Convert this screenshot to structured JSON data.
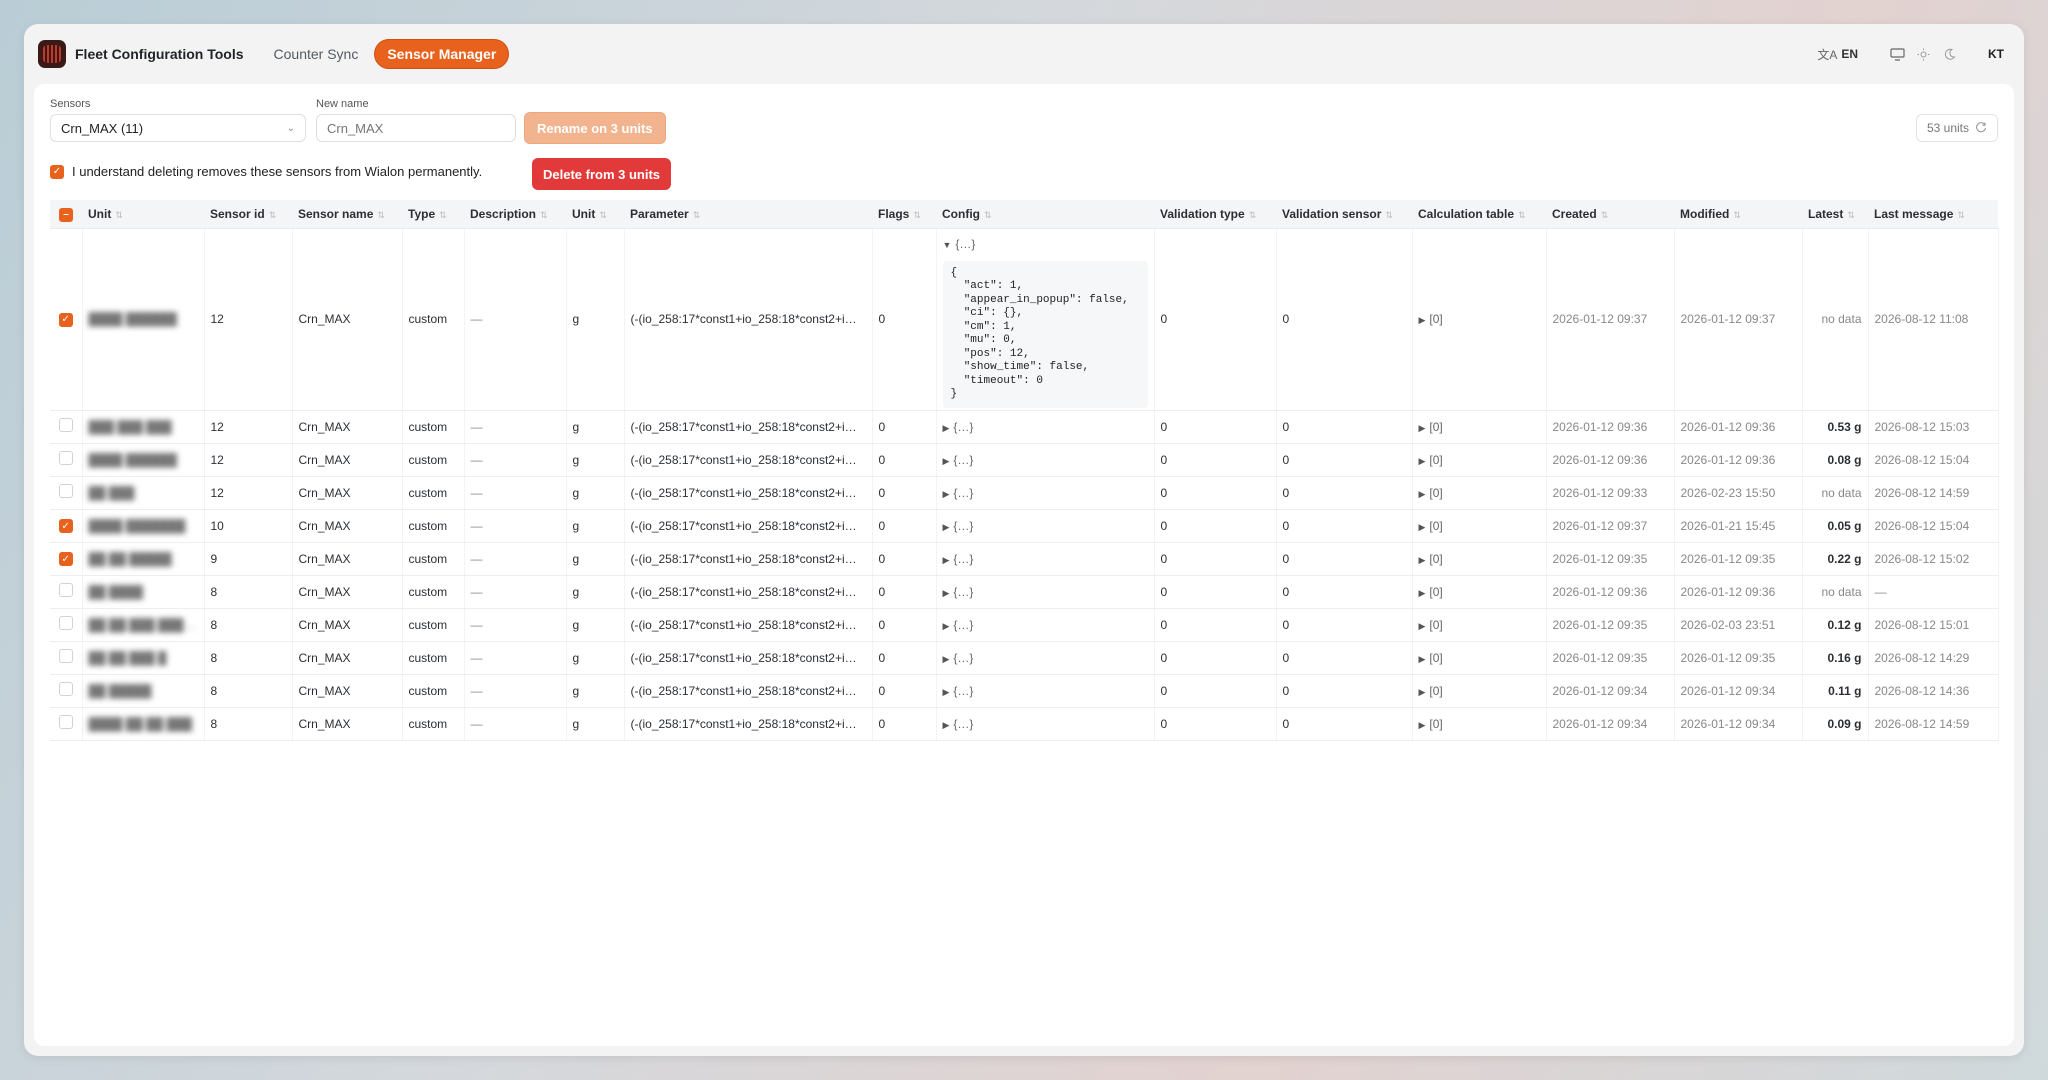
{
  "app": {
    "title": "Fleet Configuration Tools",
    "user_initials": "KT",
    "language": "EN"
  },
  "tabs": [
    {
      "label": "Counter Sync",
      "active": false
    },
    {
      "label": "Sensor Manager",
      "active": true
    }
  ],
  "form": {
    "sensors_label": "Sensors",
    "sensors_value": "Crn_MAX (11)",
    "new_name_label": "New name",
    "new_name_placeholder": "Crn_MAX",
    "rename_button": "Rename on 3 units",
    "units_count": "53 units"
  },
  "confirm": {
    "text": "I understand deleting removes these sensors from Wialon permanently.",
    "checked": true,
    "delete_button": "Delete from 3 units"
  },
  "table": {
    "columns": [
      "Unit",
      "Sensor id",
      "Sensor name",
      "Type",
      "Description",
      "Unit",
      "Parameter",
      "Flags",
      "Config",
      "Validation type",
      "Validation sensor",
      "Calculation table",
      "Created",
      "Modified",
      "Latest",
      "Last message"
    ],
    "config_collapsed": "{…}",
    "config_expanded_json": "{\n  \"act\": 1,\n  \"appear_in_popup\": false,\n  \"ci\": {},\n  \"cm\": 1,\n  \"mu\": 0,\n  \"pos\": 12,\n  \"show_time\": false,\n  \"timeout\": 0\n}",
    "rows": [
      {
        "checked": true,
        "unit": "████ ██████",
        "sensor_id": "12",
        "sensor_name": "Crn_MAX",
        "type": "custom",
        "description": "—",
        "unit_of": "g",
        "parameter": "(-(io_258:17*const1+io_258:18*const2+i…",
        "flags": "0",
        "expanded": true,
        "validation_type": "0",
        "validation_sensor": "0",
        "calc_table": "[0]",
        "created": "2026-01-12 09:37",
        "modified": "2026-01-12 09:37",
        "latest": "no data",
        "last_message": "2026-08-12 11:08"
      },
      {
        "checked": false,
        "unit": "███ ███ ███",
        "sensor_id": "12",
        "sensor_name": "Crn_MAX",
        "type": "custom",
        "description": "—",
        "unit_of": "g",
        "parameter": "(-(io_258:17*const1+io_258:18*const2+i…",
        "flags": "0",
        "expanded": false,
        "validation_type": "0",
        "validation_sensor": "0",
        "calc_table": "[0]",
        "created": "2026-01-12 09:36",
        "modified": "2026-01-12 09:36",
        "latest": "0.53 g",
        "last_message": "2026-08-12 15:03"
      },
      {
        "checked": false,
        "unit": "████ ██████",
        "sensor_id": "12",
        "sensor_name": "Crn_MAX",
        "type": "custom",
        "description": "—",
        "unit_of": "g",
        "parameter": "(-(io_258:17*const1+io_258:18*const2+i…",
        "flags": "0",
        "expanded": false,
        "validation_type": "0",
        "validation_sensor": "0",
        "calc_table": "[0]",
        "created": "2026-01-12 09:36",
        "modified": "2026-01-12 09:36",
        "latest": "0.08 g",
        "last_message": "2026-08-12 15:04"
      },
      {
        "checked": false,
        "unit": "██ ███",
        "sensor_id": "12",
        "sensor_name": "Crn_MAX",
        "type": "custom",
        "description": "—",
        "unit_of": "g",
        "parameter": "(-(io_258:17*const1+io_258:18*const2+i…",
        "flags": "0",
        "expanded": false,
        "validation_type": "0",
        "validation_sensor": "0",
        "calc_table": "[0]",
        "created": "2026-01-12 09:33",
        "modified": "2026-02-23 15:50",
        "latest": "no data",
        "last_message": "2026-08-12 14:59"
      },
      {
        "checked": true,
        "unit": "████ ███████",
        "sensor_id": "10",
        "sensor_name": "Crn_MAX",
        "type": "custom",
        "description": "—",
        "unit_of": "g",
        "parameter": "(-(io_258:17*const1+io_258:18*const2+i…",
        "flags": "0",
        "expanded": false,
        "validation_type": "0",
        "validation_sensor": "0",
        "calc_table": "[0]",
        "created": "2026-01-12 09:37",
        "modified": "2026-01-21 15:45",
        "latest": "0.05 g",
        "last_message": "2026-08-12 15:04"
      },
      {
        "checked": true,
        "unit": "██ ██ █████",
        "sensor_id": "9",
        "sensor_name": "Crn_MAX",
        "type": "custom",
        "description": "—",
        "unit_of": "g",
        "parameter": "(-(io_258:17*const1+io_258:18*const2+i…",
        "flags": "0",
        "expanded": false,
        "validation_type": "0",
        "validation_sensor": "0",
        "calc_table": "[0]",
        "created": "2026-01-12 09:35",
        "modified": "2026-01-12 09:35",
        "latest": "0.22 g",
        "last_message": "2026-08-12 15:02"
      },
      {
        "checked": false,
        "unit": "██ ████",
        "sensor_id": "8",
        "sensor_name": "Crn_MAX",
        "type": "custom",
        "description": "—",
        "unit_of": "g",
        "parameter": "(-(io_258:17*const1+io_258:18*const2+i…",
        "flags": "0",
        "expanded": false,
        "validation_type": "0",
        "validation_sensor": "0",
        "calc_table": "[0]",
        "created": "2026-01-12 09:36",
        "modified": "2026-01-12 09:36",
        "latest": "no data",
        "last_message": "—"
      },
      {
        "checked": false,
        "unit": "██ ██ ███ █████",
        "sensor_id": "8",
        "sensor_name": "Crn_MAX",
        "type": "custom",
        "description": "—",
        "unit_of": "g",
        "parameter": "(-(io_258:17*const1+io_258:18*const2+i…",
        "flags": "0",
        "expanded": false,
        "validation_type": "0",
        "validation_sensor": "0",
        "calc_table": "[0]",
        "created": "2026-01-12 09:35",
        "modified": "2026-02-03 23:51",
        "latest": "0.12 g",
        "last_message": "2026-08-12 15:01"
      },
      {
        "checked": false,
        "unit": "██ ██ ███ █",
        "sensor_id": "8",
        "sensor_name": "Crn_MAX",
        "type": "custom",
        "description": "—",
        "unit_of": "g",
        "parameter": "(-(io_258:17*const1+io_258:18*const2+i…",
        "flags": "0",
        "expanded": false,
        "validation_type": "0",
        "validation_sensor": "0",
        "calc_table": "[0]",
        "created": "2026-01-12 09:35",
        "modified": "2026-01-12 09:35",
        "latest": "0.16 g",
        "last_message": "2026-08-12 14:29"
      },
      {
        "checked": false,
        "unit": "██ █████",
        "sensor_id": "8",
        "sensor_name": "Crn_MAX",
        "type": "custom",
        "description": "—",
        "unit_of": "g",
        "parameter": "(-(io_258:17*const1+io_258:18*const2+i…",
        "flags": "0",
        "expanded": false,
        "validation_type": "0",
        "validation_sensor": "0",
        "calc_table": "[0]",
        "created": "2026-01-12 09:34",
        "modified": "2026-01-12 09:34",
        "latest": "0.11 g",
        "last_message": "2026-08-12 14:36"
      },
      {
        "checked": false,
        "unit": "████ ██ ██ ███",
        "sensor_id": "8",
        "sensor_name": "Crn_MAX",
        "type": "custom",
        "description": "—",
        "unit_of": "g",
        "parameter": "(-(io_258:17*const1+io_258:18*const2+i…",
        "flags": "0",
        "expanded": false,
        "validation_type": "0",
        "validation_sensor": "0",
        "calc_table": "[0]",
        "created": "2026-01-12 09:34",
        "modified": "2026-01-12 09:34",
        "latest": "0.09 g",
        "last_message": "2026-08-12 14:59"
      }
    ]
  },
  "colors": {
    "accent": "#e8621d",
    "danger": "#e23a3a",
    "rename_disabled": "#f2b48f"
  }
}
